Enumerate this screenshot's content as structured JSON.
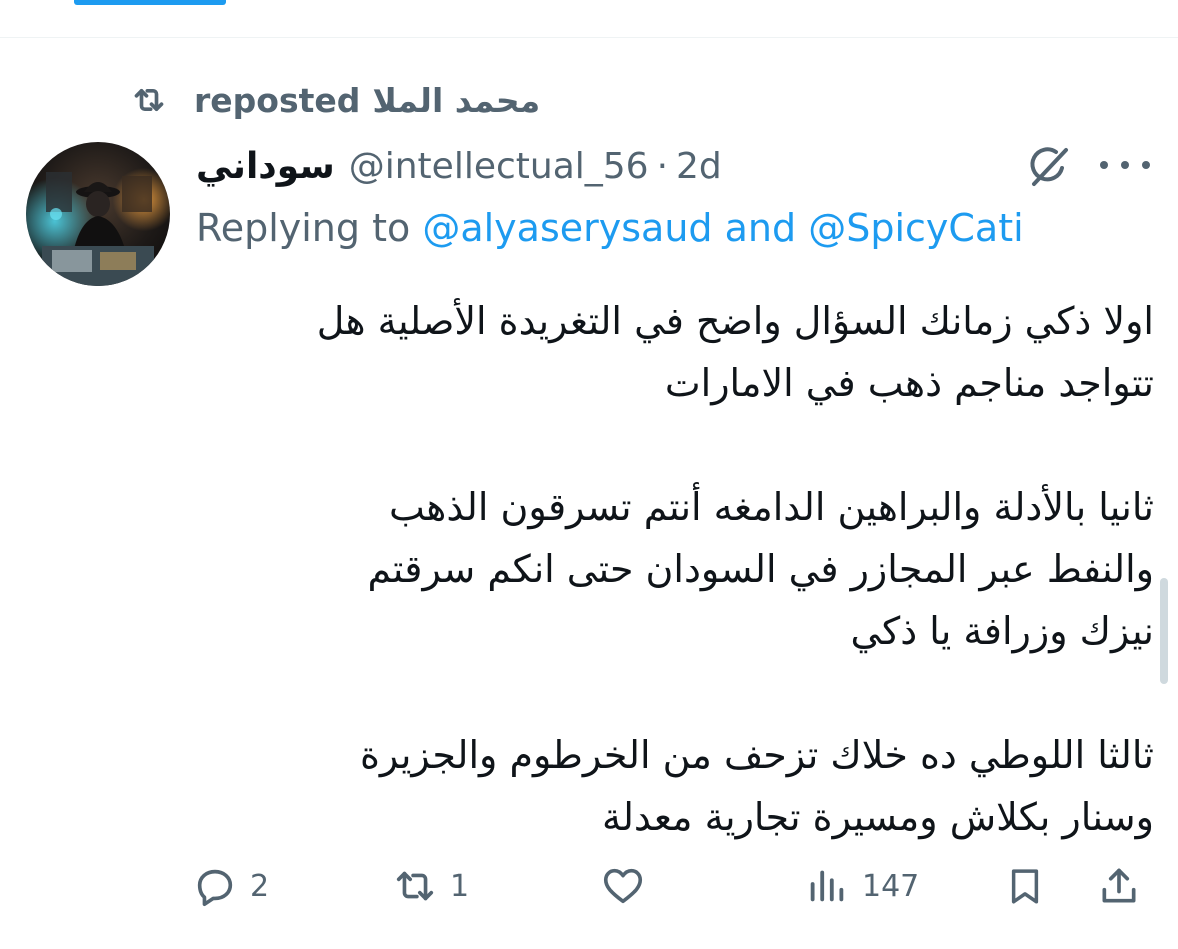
{
  "repost": {
    "reposter": "محمد الملا",
    "label": "reposted"
  },
  "author": {
    "display_name": "سوداني",
    "handle": "@intellectual_56",
    "separator": "·",
    "time": "2d"
  },
  "reply": {
    "prefix": "Replying to",
    "mention_1": "@alyaserysaud",
    "conjunction": "and",
    "mention_2": "@SpicyCati"
  },
  "tweet": {
    "lines": [
      "اولا ذكي زمانك السؤال واضح في التغريدة الأصلية هل",
      "تتواجد مناجم ذهب في الامارات",
      "",
      "ثانيا بالأدلة والبراهين الدامغه أنتم تسرقون الذهب",
      "والنفط عبر المجازر في السودان حتى انكم سرقتم",
      "نيزك وزرافة يا ذكي",
      "",
      "ثالثا اللوطي ده خلاك تزحف من الخرطوم والجزيرة",
      "وسنار بكلاش ومسيرة تجارية معدلة"
    ]
  },
  "actions": {
    "replies": "2",
    "reposts": "1",
    "likes": "",
    "views": "147"
  },
  "icons": {
    "repost": "repost-icon",
    "grok": "grok-icon",
    "more": "more-icon",
    "reply": "reply-icon",
    "like": "heart-icon",
    "views": "views-icon",
    "bookmark": "bookmark-icon",
    "share": "share-icon"
  },
  "colors": {
    "accent": "#1d9bf0",
    "secondary_text": "#536471",
    "primary_text": "#0f1419"
  }
}
